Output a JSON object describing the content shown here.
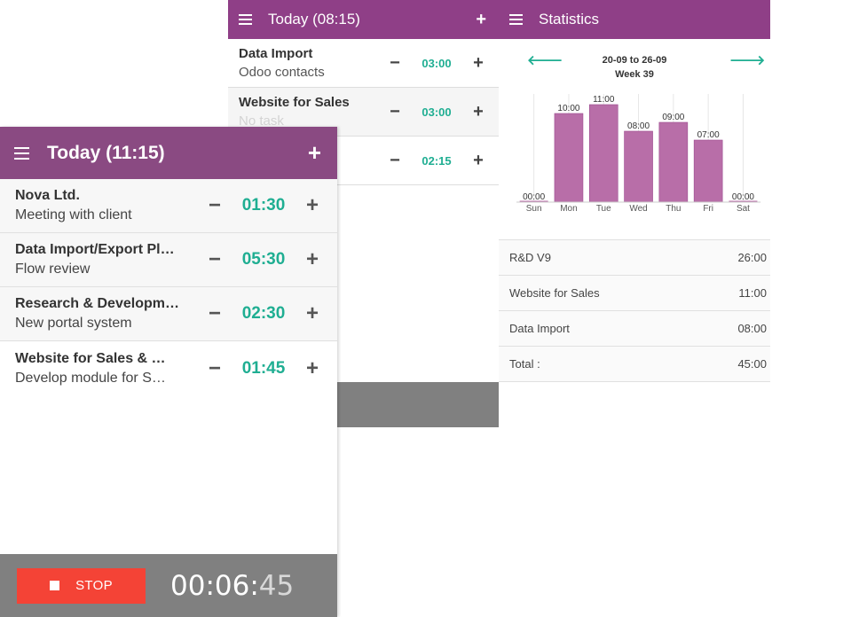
{
  "screen_middle": {
    "title": "Today (08:15)",
    "rows": [
      {
        "project": "Data Import",
        "task": "Odoo contacts",
        "duration": "03:00"
      },
      {
        "project": "Website for Sales",
        "task": "No task",
        "duration": "03:00"
      },
      {
        "project": "",
        "task": "",
        "duration": "02:15"
      }
    ]
  },
  "screen_right": {
    "title": "Statistics",
    "range": "20-09 to 26-09",
    "week": "Week 39",
    "table": [
      {
        "label": "R&D V9",
        "value": "26:00"
      },
      {
        "label": "Website for Sales",
        "value": "11:00"
      },
      {
        "label": "Data Import",
        "value": "08:00"
      },
      {
        "label": "Total :",
        "value": "45:00"
      }
    ]
  },
  "chart_data": {
    "type": "bar",
    "categories": [
      "Sun",
      "Mon",
      "Tue",
      "Wed",
      "Thu",
      "Fri",
      "Sat"
    ],
    "values": [
      0,
      10,
      11,
      8,
      9,
      7,
      0
    ],
    "labels": [
      "00:00",
      "10:00",
      "11:00",
      "08:00",
      "09:00",
      "07:00",
      "00:00"
    ],
    "ylim": [
      0,
      11
    ],
    "bar_color": "#b86ea8",
    "grid": false
  },
  "screen_left": {
    "title": "Today (11:15)",
    "rows": [
      {
        "project": "Nova Ltd.",
        "task": "Meeting with client",
        "duration": "01:30"
      },
      {
        "project": "Data Import/Export Pl…",
        "task": "Flow review",
        "duration": "05:30"
      },
      {
        "project": "Research & Developm…",
        "task": "New portal system",
        "duration": "02:30"
      },
      {
        "project": "Website for Sales & …",
        "task": "Develop module for S…",
        "duration": "01:45"
      }
    ],
    "stop_label": "STOP",
    "timer_main": "00:06:",
    "timer_seconds": "45"
  },
  "colors": {
    "header": "#8f3f87",
    "accent": "#1fae92",
    "stop": "#f44336",
    "footer": "#808080"
  },
  "icons": {
    "menu": "hamburger-icon",
    "add": "plus-icon",
    "decrease": "minus-icon",
    "prev": "arrow-left-icon",
    "next": "arrow-right-icon",
    "stop": "stop-square-icon"
  }
}
